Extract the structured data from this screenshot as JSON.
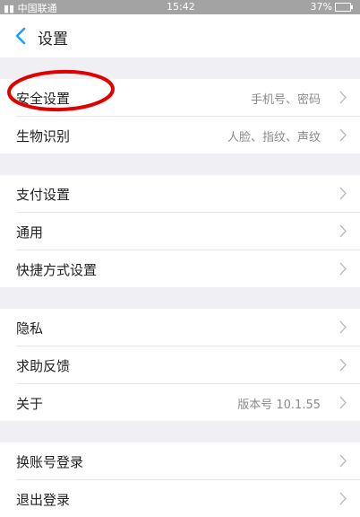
{
  "status_bar": {
    "carrier": "中国联通",
    "time": "15:42",
    "battery": "37%",
    "battery_level": 0.37
  },
  "header": {
    "title": "设置"
  },
  "groups": [
    {
      "items": [
        {
          "label": "安全设置",
          "value": "手机号、密码"
        },
        {
          "label": "生物识别",
          "value": "人脸、指纹、声纹"
        }
      ]
    },
    {
      "items": [
        {
          "label": "支付设置",
          "value": ""
        },
        {
          "label": "通用",
          "value": ""
        },
        {
          "label": "快捷方式设置",
          "value": ""
        }
      ]
    },
    {
      "items": [
        {
          "label": "隐私",
          "value": ""
        },
        {
          "label": "求助反馈",
          "value": ""
        },
        {
          "label": "关于",
          "value": "版本号 10.1.55"
        }
      ]
    },
    {
      "items": [
        {
          "label": "换账号登录",
          "value": ""
        },
        {
          "label": "退出登录",
          "value": ""
        }
      ]
    }
  ],
  "colors": {
    "accent": "#1aa0ff",
    "highlight_circle": "#e00000"
  }
}
